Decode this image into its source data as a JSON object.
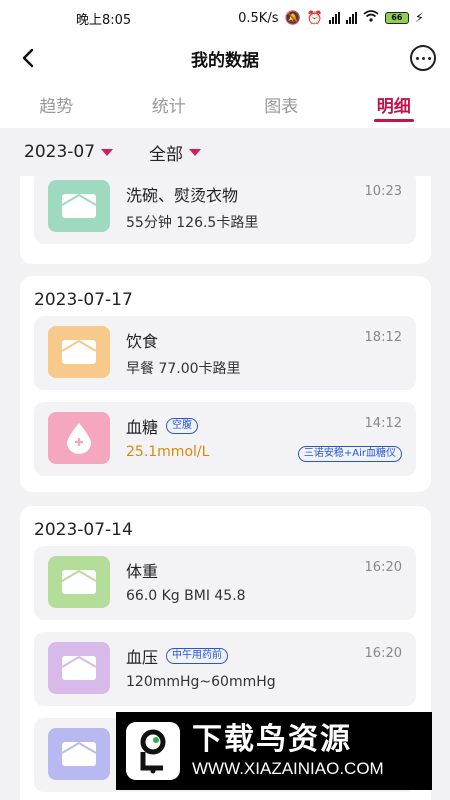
{
  "status_bar": {
    "time": "晚上8:05",
    "speed": "0.5K/s",
    "battery": "66"
  },
  "header": {
    "title": "我的数据"
  },
  "tabs": [
    {
      "label": "趋势"
    },
    {
      "label": "统计"
    },
    {
      "label": "图表"
    },
    {
      "label": "明细"
    }
  ],
  "filters": {
    "month": "2023-07",
    "category": "全部"
  },
  "groups": [
    {
      "date": "",
      "entries": [
        {
          "title": "洗碗、熨烫衣物",
          "subtitle": "55分钟 126.5卡路里",
          "time": "10:23",
          "icon": "envelope-icon",
          "icon_color": "#9ed9c0"
        }
      ]
    },
    {
      "date": "2023-07-17",
      "entries": [
        {
          "title": "饮食",
          "subtitle": "早餐 77.00卡路里",
          "time": "18:12",
          "icon": "envelope-icon",
          "icon_color": "#f7c98a"
        },
        {
          "title": "血糖",
          "tag": "空腹",
          "subtitle": "25.1mmol/L",
          "time": "14:12",
          "device": "三诺安稳+Air血糖仪",
          "icon": "blood-drop-icon",
          "icon_color": "#f4a7be"
        }
      ]
    },
    {
      "date": "2023-07-14",
      "entries": [
        {
          "title": "体重",
          "subtitle": "66.0 Kg BMI 45.8",
          "time": "16:20",
          "icon": "envelope-icon",
          "icon_color": "#b5dd9a"
        },
        {
          "title": "血压",
          "tag": "中午用药前",
          "subtitle": "120mmHg~60mmHg",
          "time": "16:20",
          "icon": "envelope-icon",
          "icon_color": "#d7b9ea"
        },
        {
          "title": "",
          "subtitle": "",
          "time": "",
          "icon": "envelope-icon",
          "icon_color": "#b9b9f2"
        }
      ]
    }
  ],
  "watermark": {
    "title": "下载鸟资源",
    "url": "WWW.XIAZAINIAO.COM"
  },
  "colors": {
    "accent": "#c0144f",
    "tag_blue": "#2a56c6"
  }
}
